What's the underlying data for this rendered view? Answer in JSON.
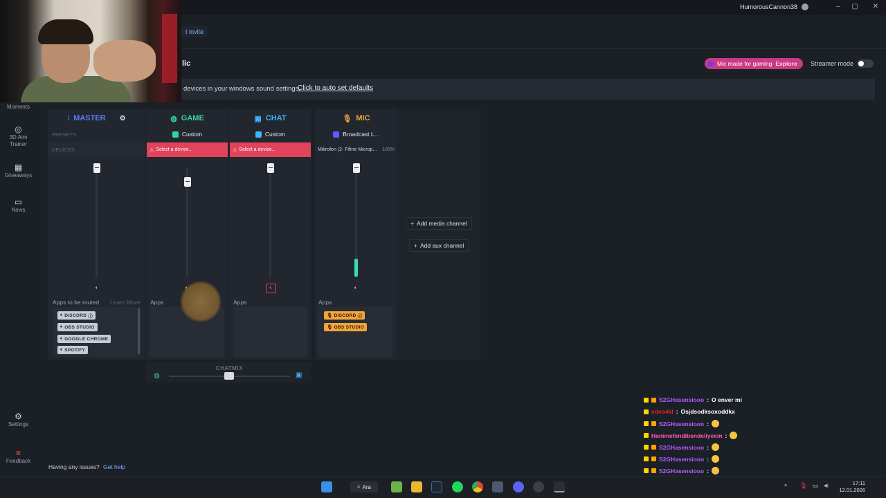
{
  "titlebar": {
    "username": "HumorousCannon38",
    "minimize": "–",
    "maximize": "▢",
    "close": "✕"
  },
  "header": {
    "invite_label": "t invite",
    "page_title": "lic",
    "banner_text": "devices in your windows sound settings.",
    "banner_link": "Click to auto set defaults",
    "promo_text": "Mic made for gaming",
    "promo_link": "Explore",
    "streamer_label": "Streamer mode"
  },
  "sidebar": [
    {
      "label": "Moments",
      "icon": "moments-icon"
    },
    {
      "label": "3D Aim\nTrainer",
      "icon": "aim-trainer-icon"
    },
    {
      "label": "Giveaways",
      "icon": "gift-icon"
    },
    {
      "label": "News",
      "icon": "news-icon"
    },
    {
      "label": "Settings",
      "icon": "gear-icon"
    },
    {
      "label": "Feedback",
      "icon": "feedback-icon"
    }
  ],
  "mixer": {
    "master": {
      "title": "MASTER",
      "presets_label": "PRESETS",
      "devices_label": "DEVICES",
      "apps_label": "Apps to be routed",
      "learn_more": "Learn More",
      "apps": [
        "DISCORD",
        "OBS STUDIO",
        "GOOGLE CHROME",
        "SPOTIFY"
      ],
      "volume": 1.0
    },
    "game": {
      "title": "GAME",
      "preset": "Custom",
      "device": "Select a device...",
      "apps_label": "Apps",
      "volume": 0.92
    },
    "chat": {
      "title": "CHAT",
      "preset": "Custom",
      "device": "Select a device...",
      "apps_label": "Apps",
      "volume": 1.0
    },
    "mic": {
      "title": "MIC",
      "preset": "Broadcast L...",
      "device": "Mikrofon (2- Fifine Microp...",
      "device_level": "100%",
      "apps_label": "Apps",
      "apps": [
        "DISCORD",
        "OBS STUDIO"
      ],
      "volume": 1.0
    },
    "add_media": "Add media channel",
    "add_aux": "Add aux channel",
    "chatmix_label": "CHATMIX",
    "chatmix_value": 0.5
  },
  "footer": {
    "issues_text": "Having any issues?",
    "help_link": "Get help"
  },
  "chat_overlay": [
    {
      "user": "S2GHasensiooo",
      "msg": "O enver mi",
      "color": "#b65cff"
    },
    {
      "user": "edos4kl",
      "msg": "Osjdsodksoxoddkx",
      "color": "#e0202c"
    },
    {
      "user": "S2GHasensiooo",
      "msg": "",
      "color": "#b65cff"
    },
    {
      "user": "Hanimefendibendeliyeem",
      "msg": "",
      "color": "#ff5cb0"
    },
    {
      "user": "S2GHasensiooo",
      "msg": "",
      "color": "#b65cff"
    },
    {
      "user": "S2GHasensiooo",
      "msg": "",
      "color": "#b65cff"
    },
    {
      "user": "S2GHasensiooo",
      "msg": "",
      "color": "#b65cff"
    }
  ],
  "taskbar": {
    "search_label": "Ara",
    "time": "17:11",
    "date": "12.01.2026"
  },
  "colors": {
    "master": "#5b7bff",
    "game": "#34d39e",
    "chat": "#3ab7ff",
    "mic": "#f0a43a",
    "error": "#e0435a"
  }
}
